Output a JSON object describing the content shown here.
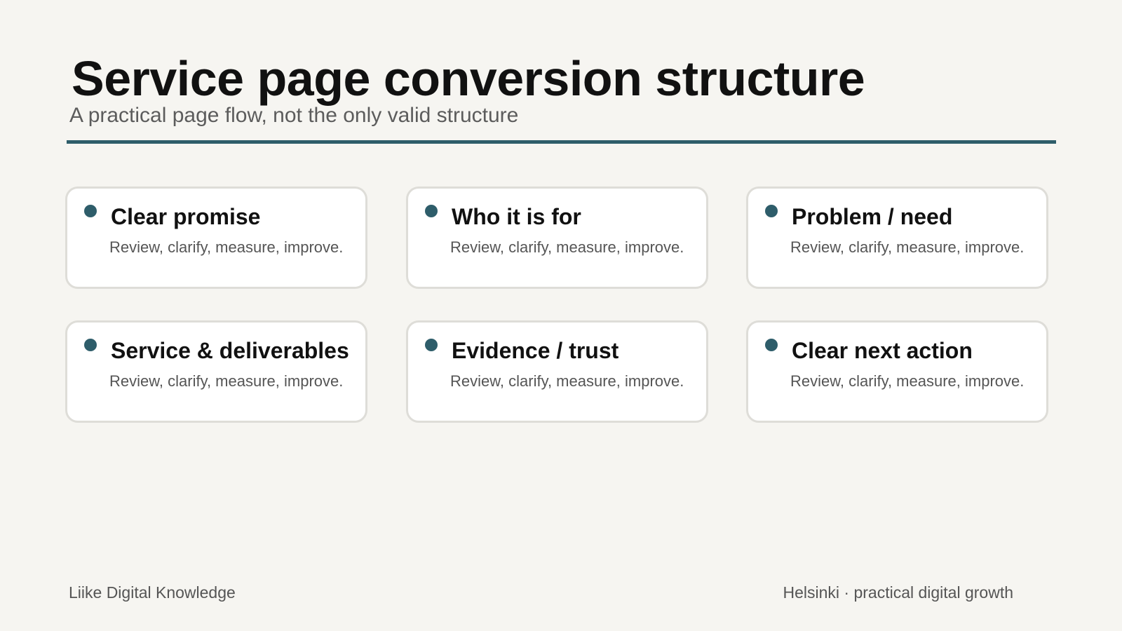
{
  "header": {
    "title": "Service page conversion structure",
    "subtitle": "A practical page flow, not the only valid structure"
  },
  "cards": [
    {
      "title": "Clear promise",
      "text": "Review, clarify, measure, improve."
    },
    {
      "title": "Who it is for",
      "text": "Review, clarify, measure, improve."
    },
    {
      "title": "Problem / need",
      "text": "Review, clarify, measure, improve."
    },
    {
      "title": "Service & deliverables",
      "text": "Review, clarify, measure, improve."
    },
    {
      "title": "Evidence / trust",
      "text": "Review, clarify, measure, improve."
    },
    {
      "title": "Clear next action",
      "text": "Review, clarify, measure, improve."
    }
  ],
  "footer": {
    "left": "Liike Digital Knowledge",
    "right": "Helsinki · practical digital growth"
  },
  "colors": {
    "accent": "#2e5d6a",
    "background": "#f6f5f1"
  },
  "icons": {
    "card_marker": "bullet-dot-icon"
  }
}
